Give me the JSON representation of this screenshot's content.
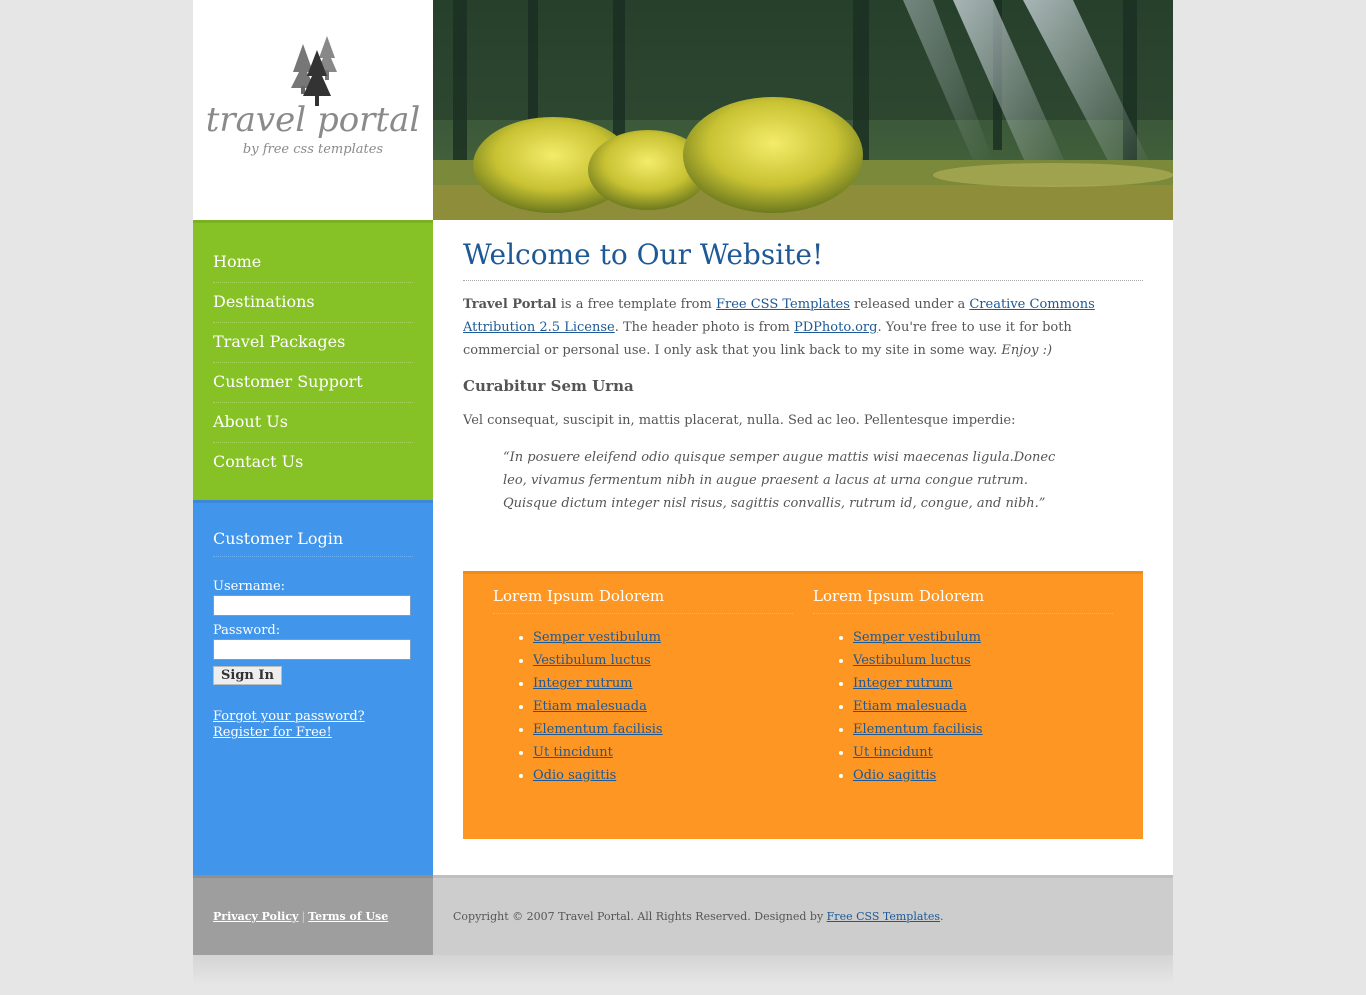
{
  "logo": {
    "name": "travel portal",
    "sub": "by free css templates"
  },
  "nav": {
    "items": [
      {
        "label": "Home"
      },
      {
        "label": "Destinations"
      },
      {
        "label": "Travel Packages"
      },
      {
        "label": "Customer Support"
      },
      {
        "label": "About Us"
      },
      {
        "label": "Contact Us"
      }
    ]
  },
  "login": {
    "title": "Customer Login",
    "username_label": "Username:",
    "password_label": "Password:",
    "username_value": "",
    "password_value": "",
    "sign_in": "Sign In",
    "forgot": "Forgot your password?",
    "register": "Register for Free!"
  },
  "main": {
    "title": "Welcome to Our Website!",
    "intro": {
      "brand": "Travel Portal",
      "t1": " is a free template from ",
      "link1": "Free CSS Templates",
      "t2": " released under a ",
      "link2": "Creative Commons Attribution 2.5 License",
      "t3": ". The header photo is from ",
      "link3": "PDPhoto.org",
      "t4": ". You're free to use it for both commercial or personal use. I only ask that you link back to my site in some way. ",
      "enjoy": "Enjoy :)"
    },
    "subheading": "Curabitur Sem Urna",
    "paragraph": "Vel consequat, suscipit in, mattis placerat, nulla. Sed ac leo. Pellentesque imperdie:",
    "quote": "“In posuere eleifend odio quisque semper augue mattis wisi maecenas ligula.Donec leo, vivamus fermentum nibh in augue praesent a lacus at urna congue rutrum. Quisque dictum integer nisl risus, sagittis convallis, rutrum id, congue, and nibh.”"
  },
  "boxes": [
    {
      "title": "Lorem Ipsum Dolorem",
      "links": [
        "Semper vestibulum",
        "Vestibulum luctus",
        "Integer rutrum",
        "Etiam malesuada",
        "Elementum facilisis",
        "Ut tincidunt",
        "Odio sagittis"
      ]
    },
    {
      "title": "Lorem Ipsum Dolorem",
      "links": [
        "Semper vestibulum",
        "Vestibulum luctus",
        "Integer rutrum",
        "Etiam malesuada",
        "Elementum facilisis",
        "Ut tincidunt",
        "Odio sagittis"
      ]
    }
  ],
  "footer": {
    "privacy": "Privacy Policy",
    "separator": "|",
    "terms": "Terms of Use",
    "copyright": "Copyright © 2007 Travel Portal. All Rights Reserved. Designed by ",
    "designer": "Free CSS Templates",
    "period": "."
  },
  "colors": {
    "nav": "#86c226",
    "login": "#4195ea",
    "box": "#fe9623",
    "heading": "#1d5996"
  }
}
